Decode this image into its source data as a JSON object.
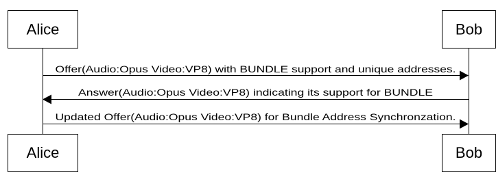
{
  "participants": {
    "left": {
      "name": "Alice"
    },
    "right": {
      "name": "Bob"
    }
  },
  "messages": [
    {
      "from": "Alice",
      "to": "Bob",
      "text": "Offer(Audio:Opus Video:VP8) with BUNDLE support and unique addresses."
    },
    {
      "from": "Bob",
      "to": "Alice",
      "text": "Answer(Audio:Opus Video:VP8) indicating its support for BUNDLE"
    },
    {
      "from": "Alice",
      "to": "Bob",
      "text": "Updated Offer(Audio:Opus Video:VP8) for Bundle Address Synchronzation."
    }
  ],
  "colors": {
    "stroke": "#000000",
    "fill": "#ffffff",
    "text": "#000000"
  }
}
